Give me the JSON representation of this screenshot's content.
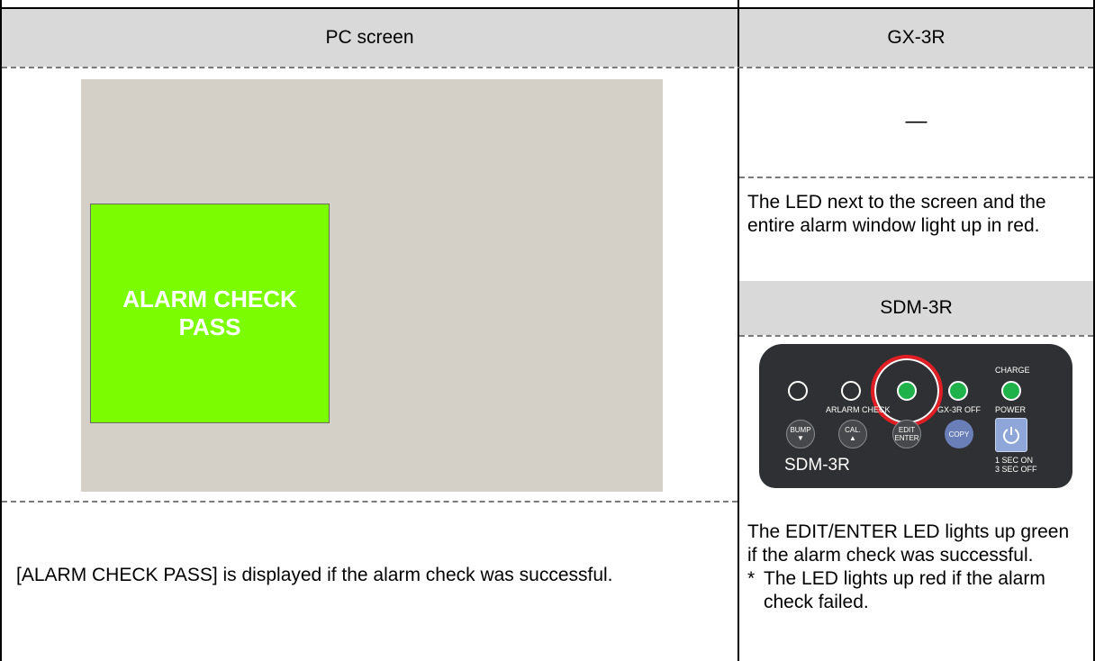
{
  "headers": {
    "pc_screen": "PC screen",
    "gx3r": "GX-3R",
    "sdm3r": "SDM-3R"
  },
  "pc_screen": {
    "message_line1": "ALARM CHECK",
    "message_line2": "PASS",
    "panel_color": "#d4d0c8",
    "message_bg_color": "#7cfc00"
  },
  "gx3r": {
    "top_cell": "—",
    "description": "The LED next to the screen and the entire alarm window light up in red."
  },
  "device": {
    "group_label": "ARLARM CHECK",
    "gx3r_off_label": "GX-3R OFF",
    "charge_label": "CHARGE",
    "power_label": "POWER",
    "button_bump": "BUMP",
    "button_cal": "CAL.",
    "button_edit": "EDIT",
    "button_enter": "ENTER",
    "button_copy": "COPY",
    "power_hint_1": "1 SEC ON",
    "power_hint_2": "3 SEC OFF",
    "model": "SDM-3R",
    "highlight_color": "#e01e24",
    "led_green_color": "#1fb24a"
  },
  "footer": {
    "pc_description": "[ALARM CHECK PASS] is displayed if the alarm check was successful.",
    "sdm_description": "The EDIT/ENTER LED lights up green if the alarm check was successful.",
    "sdm_note_marker": "*",
    "sdm_note": "The LED lights up red if the alarm check failed."
  }
}
